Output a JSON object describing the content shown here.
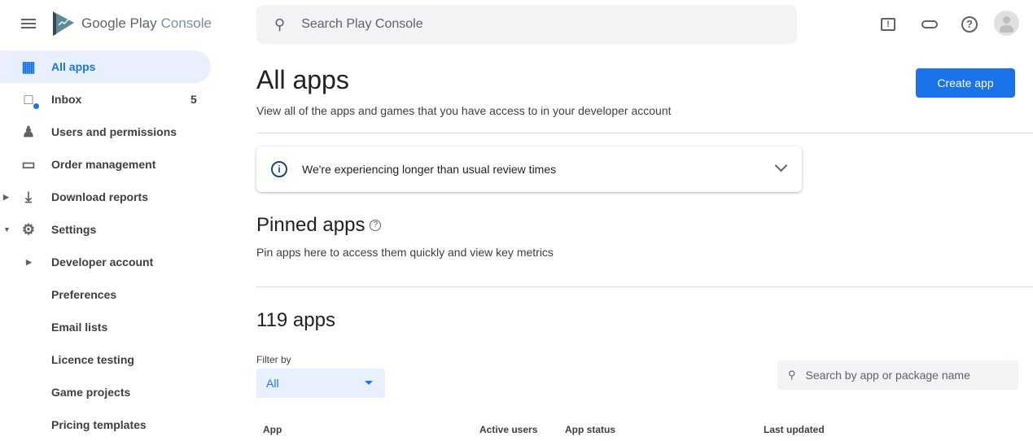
{
  "header": {
    "logo_text_1": "Google Play",
    "logo_text_2": "Console",
    "search_placeholder": "Search Play Console"
  },
  "sidebar": {
    "items": [
      {
        "label": "All apps",
        "icon": "grid-icon",
        "active": true
      },
      {
        "label": "Inbox",
        "icon": "inbox-icon",
        "badge": "5"
      },
      {
        "label": "Users and permissions",
        "icon": "users-icon"
      },
      {
        "label": "Order management",
        "icon": "credit-card-icon"
      },
      {
        "label": "Download reports",
        "icon": "download-icon"
      },
      {
        "label": "Settings",
        "icon": "gear-icon"
      },
      {
        "label": "Developer account"
      },
      {
        "label": "Preferences"
      },
      {
        "label": "Email lists"
      },
      {
        "label": "Licence testing"
      },
      {
        "label": "Game projects"
      },
      {
        "label": "Pricing templates"
      }
    ]
  },
  "main": {
    "title": "All apps",
    "subtitle": "View all of the apps and games that you have access to in your developer account",
    "create_button": "Create app",
    "notice": "We're experiencing longer than usual review times",
    "pinned_title": "Pinned apps",
    "pinned_subtitle": "Pin apps here to access them quickly and view key metrics",
    "count_title": "119 apps",
    "filter_label": "Filter by",
    "filter_value": "All",
    "search_placeholder": "Search by app or package name",
    "columns": [
      "App",
      "Active users",
      "App status",
      "Last updated"
    ]
  },
  "colors": {
    "accent": "#1a73e8",
    "active_bg": "#e8f0fe"
  }
}
